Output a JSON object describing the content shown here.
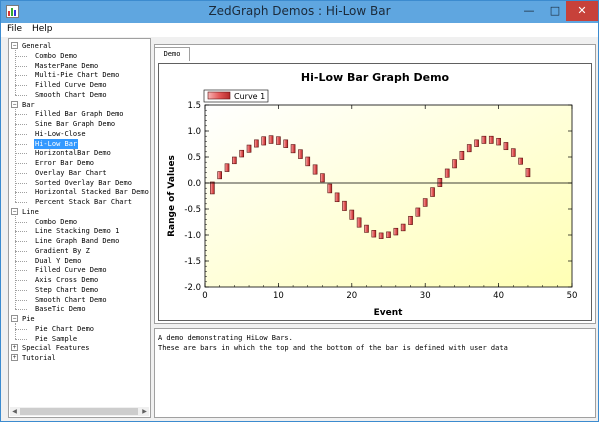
{
  "window": {
    "title": "ZedGraph Demos : Hi-Low Bar"
  },
  "menu": {
    "file": "File",
    "help": "Help"
  },
  "tree": [
    {
      "label": "General",
      "level": 0,
      "expander": "−"
    },
    {
      "label": "Combo Demo",
      "level": 1
    },
    {
      "label": "MasterPane Demo",
      "level": 1
    },
    {
      "label": "Multi-Pie Chart Demo",
      "level": 1
    },
    {
      "label": "Filled Curve Demo",
      "level": 1
    },
    {
      "label": "Smooth Chart Demo",
      "level": 1
    },
    {
      "label": "Bar",
      "level": 0,
      "expander": "−"
    },
    {
      "label": "Filled Bar Graph Demo",
      "level": 1
    },
    {
      "label": "Sine Bar Graph Demo",
      "level": 1
    },
    {
      "label": "Hi-Low-Close",
      "level": 1
    },
    {
      "label": "Hi-Low Bar",
      "level": 1,
      "selected": true
    },
    {
      "label": "HorizontalBar Demo",
      "level": 1
    },
    {
      "label": "Error Bar Demo",
      "level": 1
    },
    {
      "label": "Overlay Bar Chart",
      "level": 1
    },
    {
      "label": "Sorted Overlay Bar Demo",
      "level": 1
    },
    {
      "label": "Horizontal Stacked Bar Demo",
      "level": 1
    },
    {
      "label": "Percent Stack Bar Chart",
      "level": 1
    },
    {
      "label": "Line",
      "level": 0,
      "expander": "−"
    },
    {
      "label": "Combo Demo",
      "level": 1
    },
    {
      "label": "Line Stacking Demo 1",
      "level": 1
    },
    {
      "label": "Line Graph Band Demo",
      "level": 1
    },
    {
      "label": "Gradient By Z",
      "level": 1
    },
    {
      "label": "Dual Y Demo",
      "level": 1
    },
    {
      "label": "Filled Curve Demo",
      "level": 1
    },
    {
      "label": "Axis Cross Demo",
      "level": 1
    },
    {
      "label": "Step Chart Demo",
      "level": 1
    },
    {
      "label": "Smooth Chart Demo",
      "level": 1
    },
    {
      "label": "BaseTic Demo",
      "level": 1
    },
    {
      "label": "Pie",
      "level": 0,
      "expander": "−"
    },
    {
      "label": "Pie Chart Demo",
      "level": 1
    },
    {
      "label": "Pie Sample",
      "level": 1
    },
    {
      "label": "Special Features",
      "level": 0,
      "expander": "+"
    },
    {
      "label": "Tutorial",
      "level": 0,
      "expander": "+"
    }
  ],
  "tab": {
    "label": "Demo"
  },
  "description": {
    "line1": "A demo demonstrating HiLow Bars.",
    "line2": "These are bars in which the top and the bottom of the bar is defined with user data"
  },
  "colors": {
    "bar_fill": "#e45a5a",
    "bar_edge": "#5a1010",
    "chart_fill_light": "#ffffff",
    "chart_fill_dark": "#ffffb4"
  },
  "chart_data": {
    "type": "bar",
    "subtype": "hi-low",
    "title": "Hi-Low Bar Graph Demo",
    "xlabel": "Event",
    "ylabel": "Range of Values",
    "xlim": [
      0,
      50
    ],
    "ylim": [
      -2.0,
      1.5
    ],
    "xticks": [
      "0",
      "10",
      "20",
      "30",
      "40",
      "50"
    ],
    "yticks": [
      "-2.0",
      "-1.5",
      "-1.0",
      "-0.5",
      "0.0",
      "0.5",
      "1.0",
      "1.5"
    ],
    "legend_position": "top-left",
    "zero_line": true,
    "series": [
      {
        "name": "Curve 1",
        "x": [
          1,
          2,
          3,
          4,
          5,
          6,
          7,
          8,
          9,
          10,
          11,
          12,
          13,
          14,
          15,
          16,
          17,
          18,
          19,
          20,
          21,
          22,
          23,
          24,
          25,
          26,
          27,
          28,
          29,
          30,
          31,
          32,
          33,
          34,
          35,
          36,
          37,
          38,
          39,
          40,
          41,
          42,
          43,
          44
        ],
        "low": [
          -0.21,
          0.08,
          0.22,
          0.37,
          0.5,
          0.59,
          0.69,
          0.73,
          0.76,
          0.74,
          0.68,
          0.58,
          0.47,
          0.33,
          0.17,
          0.02,
          -0.19,
          -0.36,
          -0.53,
          -0.7,
          -0.85,
          -0.95,
          -1.04,
          -1.07,
          -1.05,
          -1.0,
          -0.92,
          -0.8,
          -0.64,
          -0.45,
          -0.26,
          -0.07,
          0.11,
          0.29,
          0.45,
          0.6,
          0.7,
          0.76,
          0.76,
          0.73,
          0.64,
          0.51,
          0.36,
          0.12
        ],
        "high": [
          0.02,
          0.22,
          0.37,
          0.5,
          0.63,
          0.73,
          0.83,
          0.89,
          0.91,
          0.89,
          0.83,
          0.74,
          0.64,
          0.5,
          0.35,
          0.18,
          -0.02,
          -0.19,
          -0.35,
          -0.52,
          -0.67,
          -0.81,
          -0.91,
          -0.96,
          -0.94,
          -0.87,
          -0.79,
          -0.64,
          -0.48,
          -0.3,
          -0.09,
          0.09,
          0.27,
          0.45,
          0.61,
          0.74,
          0.83,
          0.9,
          0.9,
          0.86,
          0.78,
          0.66,
          0.48,
          0.28
        ]
      }
    ]
  }
}
